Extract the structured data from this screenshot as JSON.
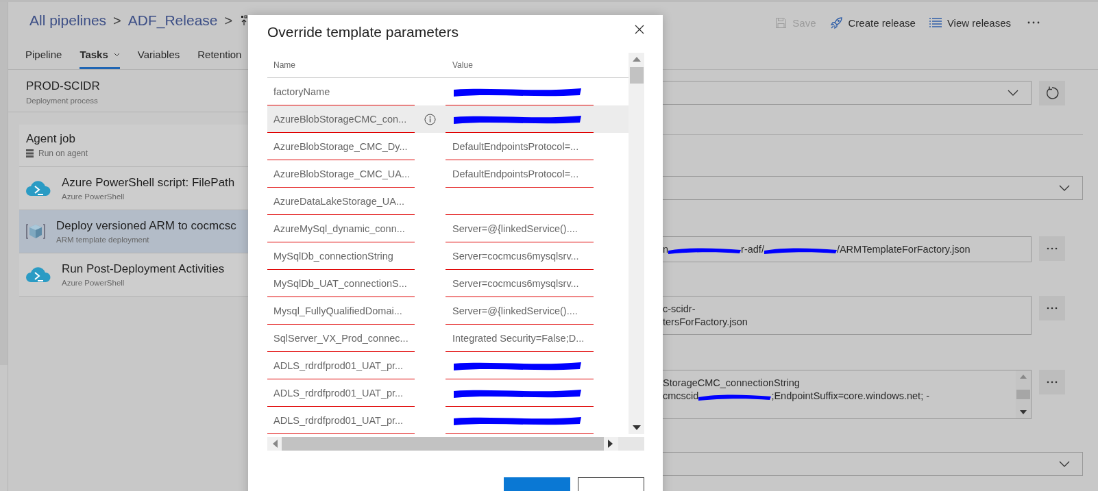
{
  "breadcrumb": [
    {
      "label": "All pipelines",
      "separator": ">"
    },
    {
      "label": "ADF_Release",
      "separator": ">"
    }
  ],
  "toolbar": [
    {
      "kind": "save",
      "label": "Save",
      "disabled": true
    },
    {
      "kind": "release",
      "label": "Create release",
      "disabled": false
    },
    {
      "kind": "list",
      "label": "View releases",
      "disabled": false
    }
  ],
  "tabs": [
    {
      "label": "Pipeline",
      "selected": false,
      "dropdown": false
    },
    {
      "label": "Tasks",
      "selected": true,
      "dropdown": true
    },
    {
      "label": "Variables",
      "selected": false,
      "dropdown": false
    },
    {
      "label": "Retention",
      "selected": false,
      "dropdown": false
    }
  ],
  "stage": {
    "title": "PROD-SCIDR",
    "subtitle": "Deployment process"
  },
  "job": {
    "title": "Agent job",
    "subtitle": "Run on agent"
  },
  "tasks": [
    {
      "kind": "powershell",
      "title": "Azure PowerShell script: FilePath",
      "subtitle": "Azure PowerShell",
      "selected": false
    },
    {
      "kind": "arm",
      "title": "Deploy versioned ARM to cocmcsc",
      "subtitle": "ARM template deployment",
      "selected": true
    },
    {
      "kind": "powershell",
      "title": "Run Post-Deployment Activities",
      "subtitle": "Azure PowerShell",
      "selected": false
    }
  ],
  "fields": [
    {
      "kind": "select",
      "refresh": true
    },
    {
      "kind": "select",
      "refresh": false
    },
    {
      "kind": "input",
      "more": true,
      "lines": [
        [
          {
            "text": "n"
          },
          {
            "redacted": true
          },
          {
            "text": "r-adf/"
          },
          {
            "redacted": true
          },
          {
            "text": "/ARMTemplateForFactory.json"
          }
        ]
      ]
    },
    {
      "kind": "input",
      "more": true,
      "lines": [
        [
          {
            "text": "c-scidr-"
          }
        ],
        [
          {
            "text": "tersForFactory.json"
          }
        ]
      ]
    },
    {
      "kind": "textarea",
      "more": true,
      "lines": [
        [
          {
            "text": "StorageCMC_connectionString"
          }
        ],
        [
          {
            "text": "cmcscid"
          },
          {
            "redacted": true
          },
          {
            "text": ";EndpointSuffix=core.windows.net; -"
          }
        ]
      ]
    },
    {
      "kind": "select",
      "refresh": false
    }
  ],
  "dialog": {
    "title": "Override template parameters",
    "columns": [
      "Name",
      "Value"
    ],
    "rows": [
      {
        "name": "factoryName",
        "redacted": true,
        "highlighted": false,
        "info": false
      },
      {
        "name": "AzureBlobStorageCMC_con...",
        "redacted": true,
        "highlighted": true,
        "info": true
      },
      {
        "name": "AzureBlobStorage_CMC_Dy...",
        "value": "DefaultEndpointsProtocol=...",
        "redacted": false,
        "highlighted": false,
        "info": false
      },
      {
        "name": "AzureBlobStorage_CMC_UA...",
        "value": "DefaultEndpointsProtocol=...",
        "redacted": false,
        "highlighted": false,
        "info": false
      },
      {
        "name": "AzureDataLakeStorage_UA...",
        "redacted": false,
        "highlighted": false,
        "info": false
      },
      {
        "name": "AzureMySql_dynamic_conn...",
        "value": "Server=@{linkedService()....",
        "redacted": false,
        "highlighted": false,
        "info": false
      },
      {
        "name": "MySqlDb_connectionString",
        "value": "Server=cocmcus6mysqlsrv...",
        "redacted": false,
        "highlighted": false,
        "info": false
      },
      {
        "name": "MySqlDb_UAT_connectionS...",
        "value": "Server=cocmcus6mysqlsrv...",
        "redacted": false,
        "highlighted": false,
        "info": false
      },
      {
        "name": "Mysql_FullyQualifiedDomai...",
        "value": "Server=@{linkedService()....",
        "redacted": false,
        "highlighted": false,
        "info": false
      },
      {
        "name": "SqlServer_VX_Prod_connec...",
        "value": "Integrated Security=False;D...",
        "redacted": false,
        "highlighted": false,
        "info": false
      },
      {
        "name": "ADLS_rdrdfprod01_UAT_pr...",
        "redacted": true,
        "highlighted": false,
        "info": false
      },
      {
        "name": "ADLS_rdrdfprod01_UAT_pr...",
        "redacted": true,
        "highlighted": false,
        "info": false
      },
      {
        "name": "ADLS_rdrdfprod01_UAT_pr...",
        "redacted": true,
        "highlighted": false,
        "info": false
      }
    ],
    "buttons": [
      {
        "kind": "primary"
      },
      {
        "kind": "secondary"
      }
    ]
  }
}
